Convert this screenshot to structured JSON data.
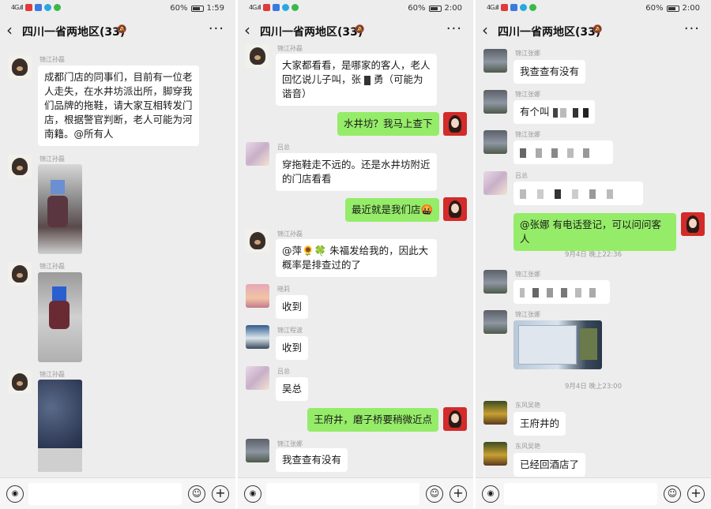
{
  "panels": [
    {
      "status": {
        "signal": "4G.ıll",
        "battery": "60%",
        "time": "1:59"
      },
      "header": {
        "title": "四川一省两地区(33)"
      },
      "messages": [
        {
          "sender": "锦江孙磊",
          "text": "成都门店的同事们，目前有一位老人走失，在水井坊派出所，脚穿我们品牌的拖鞋，请大家互相转发门店，根据警官判断，老人可能为河南籍。@所有人"
        },
        {
          "sender": "锦江孙磊",
          "type": "photo"
        },
        {
          "sender": "锦江孙磊",
          "type": "photo"
        },
        {
          "sender": "锦江孙磊",
          "type": "photo"
        }
      ]
    },
    {
      "status": {
        "signal": "4G.ıll",
        "battery": "60%",
        "time": "2:00"
      },
      "header": {
        "title": "四川一省两地区(33)"
      },
      "messages": [
        {
          "sender": "锦江孙磊",
          "text": "大家都看看，是哪家的客人，老人回忆说儿子叫，张",
          "text_tail": "勇（可能为谐音）"
        },
        {
          "sender": "me",
          "text": "水井坊？我马上查下"
        },
        {
          "sender": "吕总",
          "text": "穿拖鞋走不远的。还是水井坊附近的门店看看"
        },
        {
          "sender": "me",
          "text": "最近就是我们店🤬"
        },
        {
          "sender": "锦江孙磊",
          "text": "@萍🌻🍀 朱福发给我的，因此大概率是排查过的了"
        },
        {
          "sender": "晓莉",
          "text": "收到"
        },
        {
          "sender": "锦江程波",
          "text": "收到"
        },
        {
          "sender": "吕总",
          "text": "吴总"
        },
        {
          "sender": "me",
          "text": "王府井，磨子桥要稍微近点"
        },
        {
          "sender": "锦江张娜",
          "text": "我查查有没有"
        }
      ]
    },
    {
      "status": {
        "signal": "4G.ıll",
        "battery": "60%",
        "time": "2:00"
      },
      "header": {
        "title": "四川一省两地区(33)"
      },
      "messages": [
        {
          "sender": "锦江张娜",
          "text": "我查查有没有"
        },
        {
          "sender": "锦江张娜",
          "text": "有个叫"
        },
        {
          "sender": "锦江张娜",
          "text": ""
        },
        {
          "sender": "吕总",
          "text": ""
        },
        {
          "sender": "me",
          "text": "@张娜  有电话登记，可以问问客人"
        },
        {
          "type": "time",
          "text": "9月4日 晚上22:36"
        },
        {
          "sender": "锦江张娜",
          "text": ""
        },
        {
          "sender": "锦江张娜",
          "type": "photo"
        },
        {
          "type": "time",
          "text": "9月4日 晚上23:00"
        },
        {
          "sender": "东风吴艳",
          "text": "王府井的"
        },
        {
          "sender": "东风吴艳",
          "text": "已经回酒店了"
        }
      ]
    }
  ],
  "colors": {
    "my_bubble": "#95ec69",
    "bubble": "#ffffff",
    "background": "#ededed"
  }
}
